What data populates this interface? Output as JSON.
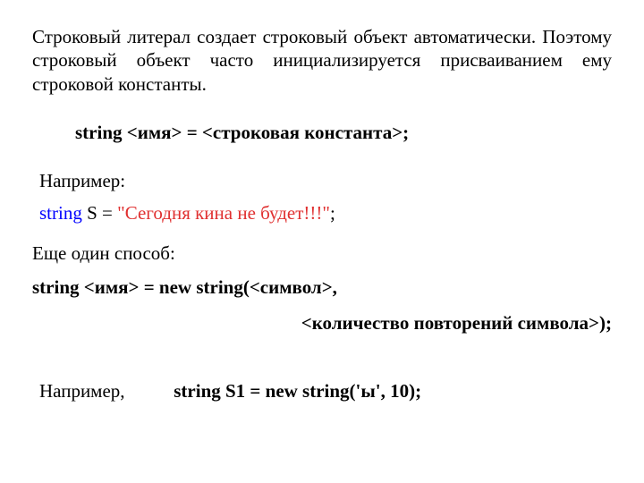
{
  "intro": "Строковый литерал создает строковый объект автоматически. Поэтому строковый объект часто инициализируется присваиванием ему строковой константы.",
  "syntax1": "string  <имя> = <строковая константа>;",
  "exampleLabel": "Например:",
  "code": {
    "decl": "string",
    "varname": " S ",
    "assign": "= ",
    "literal": "\"Сегодня кина не будет!!!\"",
    "semi": ";"
  },
  "moreWay": "Еще один способ:",
  "syntax2a": "string <имя> = new string(<символ>,",
  "syntax2b": "<количество повторений символа>);",
  "exampleLabel2": "Например,",
  "example2code": "string S1 = new string('ы', 10);"
}
